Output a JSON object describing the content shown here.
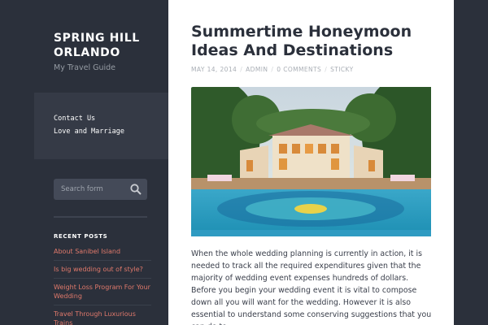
{
  "site": {
    "title": "SPRING HILL ORLANDO",
    "tagline": "My Travel Guide"
  },
  "menu": {
    "items": [
      "Contact Us",
      "Love and Marriage"
    ]
  },
  "search": {
    "placeholder": "Search form",
    "icon": "search-icon"
  },
  "recent_posts": {
    "heading": "RECENT POSTS",
    "items": [
      "About Sanibel Island",
      "Is big wedding out of style?",
      "Weight Loss Program For Your Wedding",
      "Travel Through Luxurious Trains"
    ]
  },
  "post": {
    "title": "Summertime Honeymoon Ideas And Destinations",
    "date": "MAY 14, 2014",
    "author": "ADMIN",
    "comments": "0 COMMENTS",
    "sticky": "STICKY",
    "body": "When the whole wedding planning is currently in action, it is needed to track all the required expenditures given that the majority of wedding event expenses hundreds of dollars. Before you begin your wedding event it is vital to compose down all you will want for the wedding. However it is also essential to understand some conserving suggestions that you can do to"
  },
  "colors": {
    "sidebar_bg": "#2b303b",
    "menu_bg": "#353a46",
    "link": "#e0796b",
    "title_text": "#2b303b"
  }
}
